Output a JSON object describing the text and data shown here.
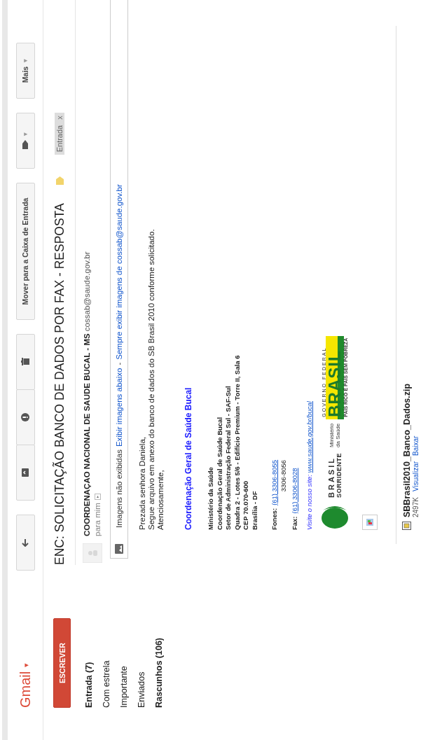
{
  "header": {
    "logo": "Gmail",
    "logo_caret": "▾"
  },
  "toolbar": [
    {
      "buttons": [
        {
          "kind": "back"
        }
      ]
    },
    {
      "buttons": [
        {
          "kind": "archive"
        },
        {
          "kind": "spam"
        },
        {
          "kind": "delete"
        }
      ]
    },
    {
      "buttons": [
        {
          "kind": "move",
          "label": "Mover para a Caixa de Entrada"
        }
      ]
    },
    {
      "buttons": [
        {
          "kind": "labels",
          "caret": "▾"
        }
      ]
    },
    {
      "buttons": [
        {
          "kind": "more",
          "label": "Mais",
          "caret": "▾"
        }
      ]
    }
  ],
  "sidebar": {
    "compose": "ESCREVER",
    "items": [
      {
        "label": "Entrada (7)",
        "unread": true
      },
      {
        "label": "Com estrela",
        "unread": false
      },
      {
        "label": "Importante",
        "unread": false
      },
      {
        "label": "Enviados",
        "unread": false
      },
      {
        "label": "Rascunhos (106)",
        "unread": true
      }
    ]
  },
  "message": {
    "subject": "ENC: SOLICITAÇÃO BANCO DE DADOS POR FAX - RESPOSTA",
    "tag": {
      "label": "Entrada",
      "close": "x"
    },
    "sender": {
      "name": "COORDENAÇAO NACIONAL DE SAUDE BUCAL - MS",
      "email": "cossab@saude.gov.br",
      "recipient": "para mim"
    },
    "images_notice": {
      "text": "Imagens não exibidas",
      "show_link": "Exibir imagens abaixo",
      "separator": "-",
      "always_link": "Sempre exibir imagens de cossab@saude.gov.br"
    },
    "body": [
      "Prezada senhora Daniela,",
      "Segue arquivo em anexo do banco de dados do SB Brasil 2010 conforme solicitado.",
      "Atenciosamente,"
    ],
    "signature": {
      "title": "Coordenação Geral de Saúde Bucal",
      "address": [
        "Ministério da Saúde",
        "Coordenação Geral de Saúde Bucal",
        "Setor de Administração Federal Sul - SAF-Sul",
        "Quadra 2 - Lotes 5/6 - Edifício Premium - Torre II, Sala 6",
        "CEP 70.070-600",
        "Brasília - DF"
      ],
      "phones_label": "Fones:",
      "phones": [
        {
          "text": "(61) 3306-8055",
          "link": true
        },
        {
          "text": "3306-8056",
          "link": false
        }
      ],
      "fax_label": "Fax:",
      "fax": "(61) 3306-8028",
      "site_label": "Visite o nosso site:",
      "site": "www.saude.gov.br/bucal"
    },
    "logos": {
      "sorridente": [
        "BRASIL",
        "SORRIDENTE"
      ],
      "ministerio": [
        "Ministério",
        "da Saúde"
      ],
      "governo": {
        "top": "GOVERNO FEDERAL",
        "word": "BRASIL",
        "motto": "PAÍS RICO É PAÍS SEM POBREZA"
      }
    },
    "attachment": {
      "name": "SBBrasil2010_Banco_Dados.zip",
      "size": "2497K",
      "links": [
        "Visualizar",
        "Baixar"
      ]
    }
  }
}
